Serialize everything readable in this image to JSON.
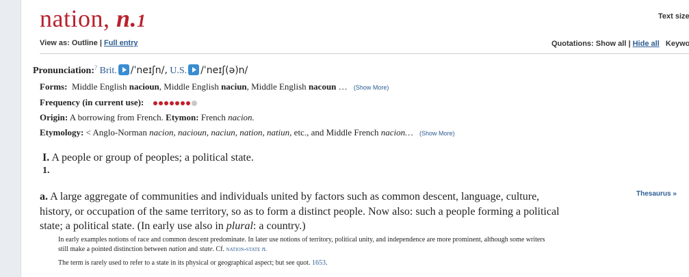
{
  "entry": {
    "headword": "nation,",
    "pos": "n.",
    "homograph": "1"
  },
  "text_size_label": "Text size",
  "toolbar": {
    "view_as_label": "View as: Outline |",
    "full_entry_link": "Full entry",
    "quotations_label": "Quotations: Show all |",
    "hide_all_link": "Hide all",
    "keywords_label": "Keywords:"
  },
  "pronunciation": {
    "label": "Pronunciation:",
    "help": "?",
    "brit_label": "Brit.",
    "brit_ipa": "/ˈneɪʃn/,",
    "us_label": "U.S.",
    "us_ipa": "/ˈneɪʃ(ə)n/"
  },
  "forms": {
    "label": "Forms:",
    "segments": [
      {
        "t": "Middle English ",
        "b": false
      },
      {
        "t": "nacioun",
        "b": true
      },
      {
        "t": ", Middle English ",
        "b": false
      },
      {
        "t": "naciun",
        "b": true
      },
      {
        "t": ", Middle English ",
        "b": false
      },
      {
        "t": "nacoun",
        "b": true
      },
      {
        "t": " …",
        "b": false
      }
    ],
    "show_more": "(Show More)"
  },
  "frequency": {
    "label": "Frequency (in current use):",
    "level": 7,
    "max": 8,
    "active_color": "#c0202c",
    "inactive_color": "#c8c8c8"
  },
  "origin": {
    "label": "Origin:",
    "text": "A borrowing from French.",
    "etymon_label": "Etymon:",
    "etymon_prefix": "French ",
    "etymon_word": "nacion."
  },
  "etymology": {
    "label": "Etymology:",
    "prefix": "< Anglo-Norman ",
    "words": "nacion, nacioun, naciun, nation, natiun,",
    "middle": " etc., and Middle French ",
    "end_word": "nacion…",
    "show_more": "(Show More)"
  },
  "senses": {
    "sense_I_label": "I.",
    "sense_I_text": "A people or group of peoples; a political state.",
    "sense_1_label": "1.",
    "sense_a_label": "a.",
    "sense_a_text": "A large aggregate of communities and individuals united by factors such as common descent, language, culture, history, or occupation of the same territory, so as to form a distinct people. Now also: such a people forming a political state; a political state. (In early use also in ",
    "sense_a_plural": "plural",
    "sense_a_end": ": a country.)",
    "thesaurus_link": "Thesaurus »"
  },
  "notes": {
    "note1_a": "In early examples notions of race and common descent predominate. In later use notions of territory, political unity, and independence are more prominent, although some writers still make a pointed distinction between ",
    "note1_nation": "nation",
    "note1_and": " and ",
    "note1_state": "state",
    "note1_cf": ". Cf. ",
    "note1_xref": "nation-state",
    "note1_xref_pos": "n.",
    "note2_text": "The term is rarely used to refer to a state in its physical or geographical aspect; but see quot. ",
    "note2_quot": "1653",
    "note2_end": "."
  },
  "colors": {
    "headword": "#b8222d",
    "link": "#2c5c93",
    "accent_play": "#3a8dd0"
  }
}
